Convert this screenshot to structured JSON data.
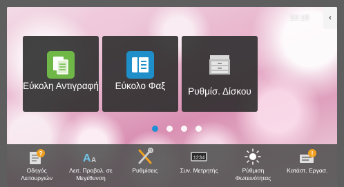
{
  "status": {
    "time": "10:15"
  },
  "side_tab": {
    "glyph": "‹"
  },
  "tiles": [
    {
      "label": "Εύκολη Αντιγραφή",
      "icon": "copy-icon",
      "color": "#6fb848"
    },
    {
      "label": "Εύκολο Φαξ",
      "icon": "fax-icon",
      "color": "#1f8fc9"
    },
    {
      "label": "Ρυθμίσ. Δίσκου",
      "icon": "tray-settings-icon",
      "color": "#9a9a9a"
    }
  ],
  "pager": {
    "count": 4,
    "active": 0
  },
  "bottom_bar": [
    {
      "label": "Οδηγός Λειτουργιών",
      "icon": "operation-guide-icon"
    },
    {
      "label": "Λειτ. Προβολ. σε Μεγέθυνση",
      "icon": "enlarge-display-icon"
    },
    {
      "label": "Ρυθμίσεις",
      "icon": "settings-tools-icon"
    },
    {
      "label": "Συν. Μετρητής",
      "icon": "total-count-icon"
    },
    {
      "label": "Ρύθμιση Φωτεινότητας",
      "icon": "brightness-icon"
    },
    {
      "label": "Κατάστ. Εργασ.",
      "icon": "job-status-icon"
    }
  ]
}
